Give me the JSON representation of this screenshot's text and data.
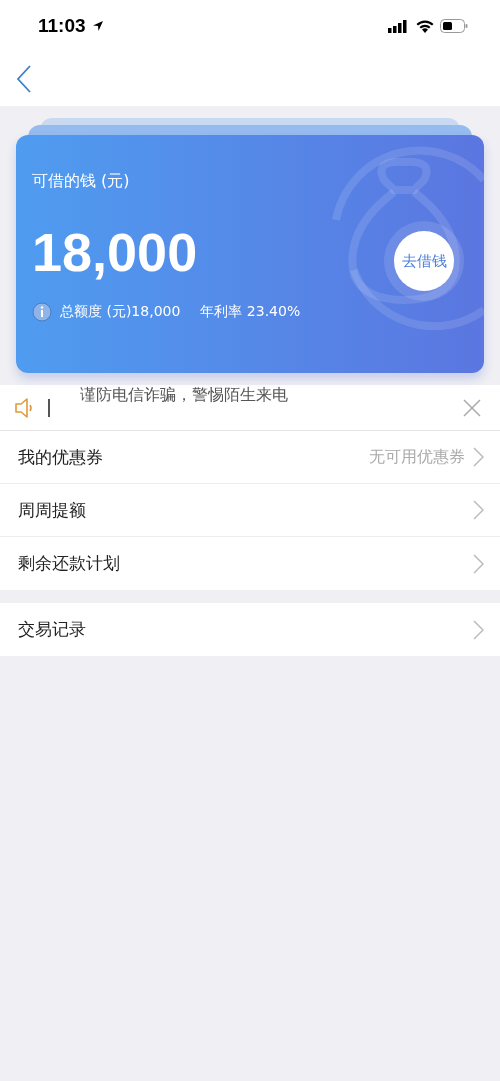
{
  "status_bar": {
    "time": "11:03"
  },
  "card": {
    "title": "可借的钱 (元)",
    "amount": "18,000",
    "button": "去借钱",
    "total": "总额度 (元)18,000",
    "rate": "年利率 23.40%"
  },
  "notice": {
    "text": "谨防电信诈骗，警惕陌生来电"
  },
  "menu_groups": [
    {
      "items": [
        {
          "label": "我的优惠券",
          "value": "无可用优惠券"
        },
        {
          "label": "周周提额"
        },
        {
          "label": "剩余还款计划"
        }
      ]
    },
    {
      "items": [
        {
          "label": "交易记录"
        }
      ]
    }
  ]
}
